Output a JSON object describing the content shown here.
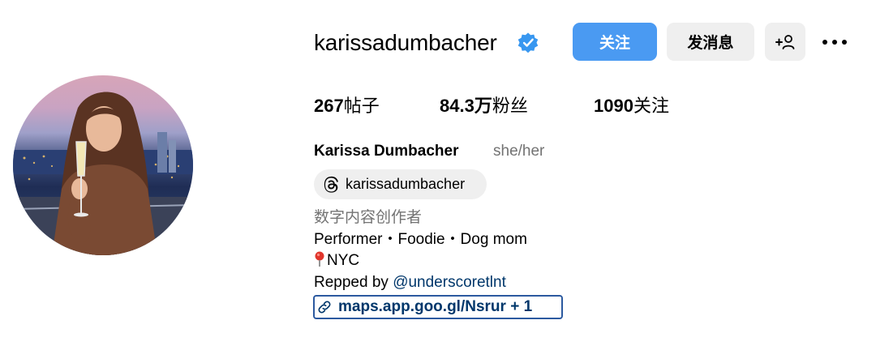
{
  "profile": {
    "username": "karissadumbacher",
    "verified_icon": "verified-badge-icon",
    "accent_color": "#4a9af2"
  },
  "actions": {
    "follow_label": "关注",
    "message_label": "发消息",
    "add_user_icon": "add-user-icon",
    "more_icon": "more-options-icon"
  },
  "stats": {
    "posts_count": "267",
    "posts_label": "帖子",
    "followers_count": "84.3万",
    "followers_label": "粉丝",
    "following_count": "1090",
    "following_label": "关注"
  },
  "bio": {
    "full_name": "Karissa Dumbacher",
    "pronouns": "she/her",
    "threads_handle": "karissadumbacher",
    "category": "数字内容创作者",
    "line1": "Performer・Foodie・Dog mom",
    "location": "NYC",
    "repped_prefix": "Repped by ",
    "repped_mention": "@underscoretlnt",
    "link_text": "maps.app.goo.gl/Nsrur + 1"
  }
}
